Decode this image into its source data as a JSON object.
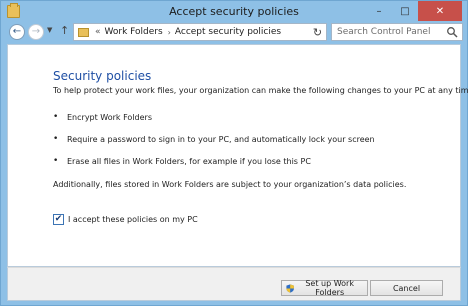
{
  "window": {
    "title": "Accept security policies",
    "caption_buttons": {
      "minimize": "–",
      "maximize": "□",
      "close": "✕"
    }
  },
  "address_bar": {
    "breadcrumbs": [
      "Work Folders",
      "Accept security policies"
    ],
    "search_placeholder": "Search Control Panel"
  },
  "content": {
    "heading": "Security policies",
    "intro": "To help protect your work files, your organization can make the following changes to your PC at any time:",
    "policies": [
      "Encrypt Work Folders",
      "Require a password to sign in to your PC, and automatically lock your screen",
      "Erase all files in Work Folders, for example if you lose this PC"
    ],
    "note": "Additionally, files stored in Work Folders are subject to your organization’s data policies.",
    "accept_label": "I accept these policies on my PC",
    "accept_checked": true
  },
  "footer": {
    "setup_label": "Set up Work Folders",
    "cancel_label": "Cancel"
  },
  "colors": {
    "frame": "#8ec0e6",
    "heading": "#1f4fa4",
    "close_button": "#c7504a"
  }
}
